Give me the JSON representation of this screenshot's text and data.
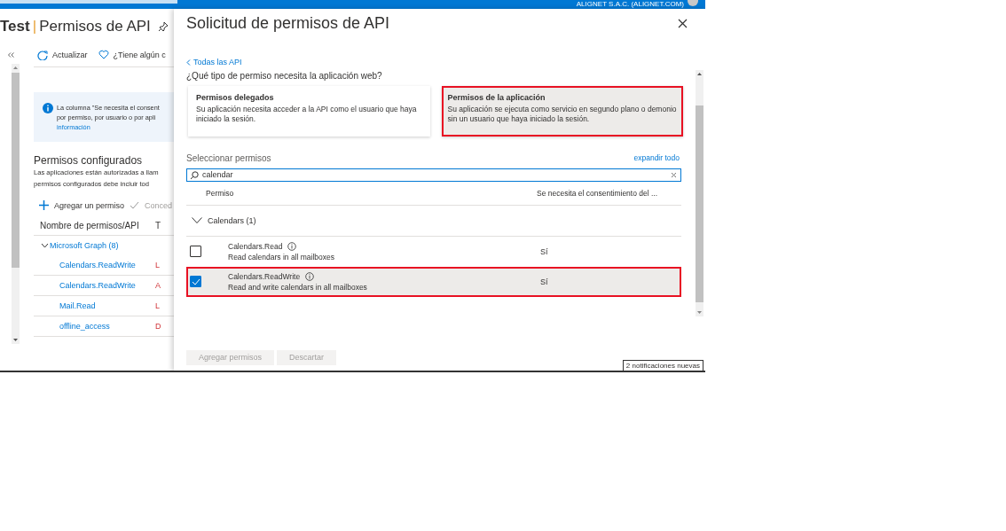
{
  "top_bar": {
    "account": "ALIGNET S.A.C. (ALIGNET.COM)"
  },
  "blade": {
    "title_app": "Test",
    "title_separator": "|",
    "title_page": "Permisos de API",
    "toolbar": [
      {
        "kind": "refresh",
        "label": "Actualizar"
      },
      {
        "kind": "feedback",
        "label": "¿Tiene algún c"
      }
    ],
    "info": [
      "La columna \"Se necesita el consent",
      "por permiso, por usuario o por apli",
      "información"
    ],
    "section_title": "Permisos configurados",
    "section_text": [
      "Las aplicaciones están autorizadas a llam",
      "permisos configurados debe incluir tod"
    ],
    "actions": [
      {
        "kind": "add",
        "label": "Agregar un permiso"
      },
      {
        "kind": "grant",
        "label": "Conced"
      }
    ],
    "table": {
      "columns": [
        "Nombre de permisos/API",
        "T"
      ],
      "groups": [
        {
          "name": "Microsoft Graph (8)",
          "expanded": true,
          "rows": [
            {
              "name": "Calendars.ReadWrite",
              "column_2": "L"
            },
            {
              "name": "Calendars.ReadWrite",
              "column_2": "A"
            },
            {
              "name": "Mail.Read",
              "column_2": "L"
            },
            {
              "name": "offline_access",
              "column_2": "D"
            }
          ]
        }
      ]
    }
  },
  "panel": {
    "title": "Solicitud de permisos de API",
    "back_link": "Todas las API",
    "question": "¿Qué tipo de permiso necesita la aplicación web?",
    "cards": [
      {
        "title": "Permisos delegados",
        "text": "Su aplicación necesita acceder a la API como el usuario que haya iniciado la sesión.",
        "selected": false,
        "highlighted": false
      },
      {
        "title": "Permisos de la aplicación",
        "text": "Su aplicación se ejecuta como servicio en segundo plano o demonio sin un usuario que haya iniciado la sesión.",
        "selected": true,
        "highlighted": true
      }
    ],
    "select_label": "Seleccionar permisos",
    "expand_all": "expandir todo",
    "search": {
      "value": "calendar"
    },
    "columns": [
      "Permiso",
      "Se necesita el consentimiento del ..."
    ],
    "groups": [
      {
        "name": "Calendars (1)",
        "expanded": true,
        "rows": [
          {
            "name": "Calendars.Read",
            "description": "Read calendars in all mailboxes",
            "consent": "Sí",
            "checked": false,
            "highlighted": false
          },
          {
            "name": "Calendars.ReadWrite",
            "description": "Read and write calendars in all mailboxes",
            "consent": "Sí",
            "checked": true,
            "highlighted": true
          }
        ]
      }
    ],
    "buttons": [
      {
        "label": "Agregar permisos",
        "disabled": true
      },
      {
        "label": "Descartar",
        "disabled": true
      }
    ]
  },
  "notification": "2 notificaciones nuevas"
}
